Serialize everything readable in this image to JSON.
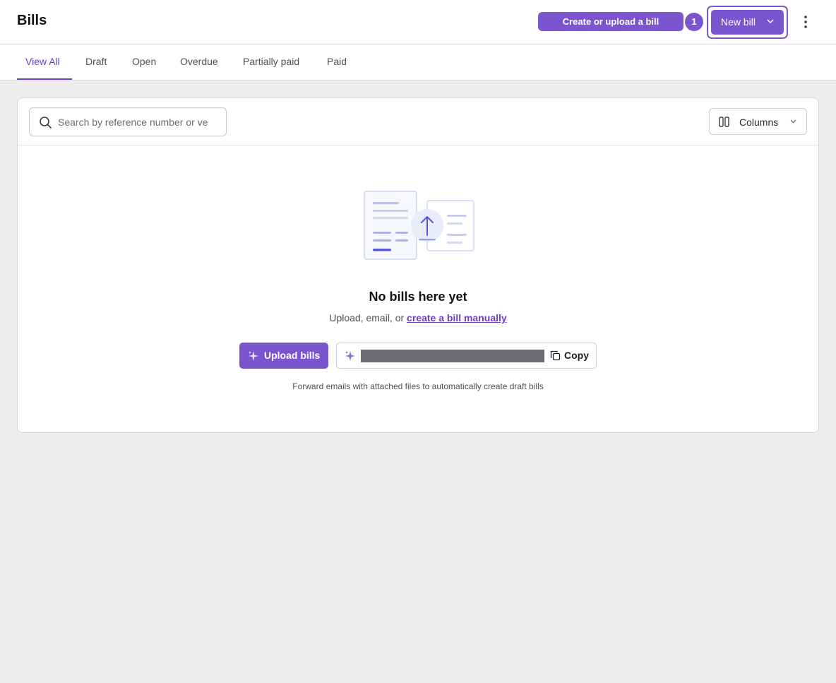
{
  "header": {
    "title": "Bills",
    "create_upload_label": "Create or upload a bill",
    "step_badge": "1",
    "new_bill_label": "New bill"
  },
  "tabs": [
    {
      "label": "View All",
      "active": true
    },
    {
      "label": "Draft",
      "active": false
    },
    {
      "label": "Open",
      "active": false
    },
    {
      "label": "Overdue",
      "active": false
    },
    {
      "label": "Partially paid",
      "active": false
    },
    {
      "label": "Paid",
      "active": false
    }
  ],
  "toolbar": {
    "search_placeholder": "Search by reference number or ve",
    "search_value": "",
    "columns_label": "Columns"
  },
  "empty_state": {
    "title": "No bills here yet",
    "subtitle_prefix": "Upload, email, or ",
    "create_manually_link": "create a bill manually",
    "upload_button": "Upload bills",
    "copy_button": "Copy",
    "forward_note": "Forward emails with attached files to automatically create draft bills"
  },
  "colors": {
    "accent": "#7b55cf",
    "accent_text": "#6a3fc2",
    "background": "#eeeeee"
  },
  "icons": {
    "search": "search-icon",
    "columns": "columns-icon",
    "chevron": "chevron-down-icon",
    "more": "more-vertical-icon",
    "sparkle": "sparkle-icon",
    "copy": "copy-icon"
  }
}
